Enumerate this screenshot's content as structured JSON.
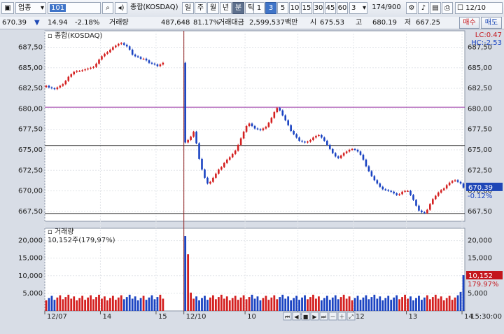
{
  "toolbar": {
    "window_icon": "window-icon",
    "category": "업종",
    "code": "101",
    "name": "종합(KOSDAQ)",
    "tabs": [
      "일",
      "주",
      "월",
      "년",
      "분",
      "틱"
    ],
    "active_tab": "분",
    "intervals": [
      "1",
      "3",
      "5",
      "10",
      "15",
      "30",
      "45",
      "60"
    ],
    "active_interval": "3",
    "interval_value": "3",
    "count": "174/900",
    "time": "12/10"
  },
  "info": {
    "price": "670.39",
    "change_arrow": "▼",
    "change": "14.94",
    "change_rate": "-2.18%",
    "volume_label": "거래량",
    "volume": "487,648",
    "volume_rate": "81.17%",
    "amount_label": "거래대금",
    "amount": "2,599,537백만",
    "open_label": "시",
    "open": "675.53",
    "high_label": "고",
    "high": "680.19",
    "low_label": "저",
    "low": "667.25",
    "buy_label": "매수",
    "sell_label": "매도"
  },
  "chart_data": {
    "type": "candlestick",
    "price_title": "종합(KOSDAQ)",
    "volume_title": "거래량",
    "volume_readout": "10,152주(179,97%)",
    "price_ticks": [
      "687,50",
      "685,00",
      "682,50",
      "680,00",
      "677,50",
      "675,00",
      "672,50",
      "670,00",
      "667,50"
    ],
    "price_tick_values": [
      687.5,
      685,
      682.5,
      680,
      677.5,
      675,
      672.5,
      670,
      667.5
    ],
    "price_range": [
      666.3,
      689.5
    ],
    "volume_ticks": [
      "20,000",
      "15,000",
      "10,000",
      "5,000"
    ],
    "volume_tick_values": [
      20000,
      15000,
      10000,
      5000
    ],
    "volume_range": [
      0,
      23500
    ],
    "lc_label": "LC:0.47",
    "hc_label": "HC:-2.53",
    "current_price_label": "670.39",
    "current_change_label": "-0.12%",
    "current_volume_label": "10,152",
    "current_volume_rate_label": "179.97%",
    "x_labels": [
      {
        "label": "12/07",
        "index": 0
      },
      {
        "label": "14",
        "index": 20
      },
      {
        "label": "15",
        "index": 40
      },
      {
        "label": "12/10",
        "index": 50
      },
      {
        "label": "10",
        "index": 72
      },
      {
        "label": "11",
        "index": 91
      },
      {
        "label": "12",
        "index": 111
      },
      {
        "label": "13",
        "index": 130
      },
      {
        "label": "14",
        "index": 150
      },
      {
        "label": "15",
        "index": 169
      }
    ],
    "hlines": [
      {
        "value": 680.19,
        "color": "#9b3aa8"
      },
      {
        "value": 675.53,
        "color": "#222222"
      },
      {
        "value": 667.25,
        "color": "#222222"
      }
    ],
    "vline_index": 50,
    "crosshair_time": "15:30:00",
    "close": [
      682.8,
      682.6,
      682.5,
      682.4,
      682.6,
      682.8,
      683.0,
      683.4,
      683.9,
      684.2,
      684.5,
      684.6,
      684.6,
      684.7,
      684.8,
      684.9,
      685.0,
      685.1,
      685.5,
      686.0,
      686.4,
      686.7,
      686.9,
      687.2,
      687.5,
      687.7,
      687.9,
      688.0,
      687.8,
      687.6,
      687.2,
      686.6,
      686.4,
      686.3,
      686.1,
      686.1,
      685.9,
      685.6,
      685.5,
      685.4,
      685.2,
      685.4,
      685.6,
      null,
      null,
      null,
      null,
      null,
      null,
      null,
      675.9,
      676.2,
      676.6,
      677.2,
      675.8,
      673.9,
      672.6,
      671.6,
      670.9,
      671.1,
      671.6,
      672.1,
      672.6,
      672.9,
      673.4,
      673.8,
      674.1,
      674.5,
      674.9,
      675.6,
      676.4,
      677.2,
      677.9,
      678.2,
      677.9,
      677.6,
      677.5,
      677.4,
      677.6,
      677.8,
      678.3,
      678.9,
      679.6,
      680.1,
      679.8,
      679.2,
      678.6,
      678.0,
      677.3,
      676.9,
      676.5,
      676.1,
      676.0,
      675.9,
      676.0,
      676.2,
      676.5,
      676.7,
      676.8,
      676.5,
      676.1,
      675.6,
      675.1,
      674.6,
      674.2,
      674.0,
      674.3,
      674.6,
      674.8,
      675.0,
      675.1,
      675.0,
      674.8,
      674.4,
      673.8,
      673.0,
      672.4,
      671.8,
      671.3,
      670.9,
      670.5,
      670.2,
      670.1,
      670.0,
      669.9,
      669.7,
      669.5,
      669.6,
      669.9,
      670.0,
      670.0,
      669.5,
      668.9,
      668.2,
      667.6,
      667.4,
      667.3,
      667.7,
      668.4,
      669.0,
      669.4,
      669.8,
      670.1,
      670.3,
      670.7,
      671.0,
      671.2,
      671.3,
      671.1,
      670.9,
      670.4
    ]
  },
  "footer": {
    "icons": [
      "first-icon",
      "prev-icon",
      "stop-icon",
      "next-icon",
      "last-icon",
      "zoom-out-icon",
      "zoom-in-icon",
      "fit-icon"
    ]
  }
}
